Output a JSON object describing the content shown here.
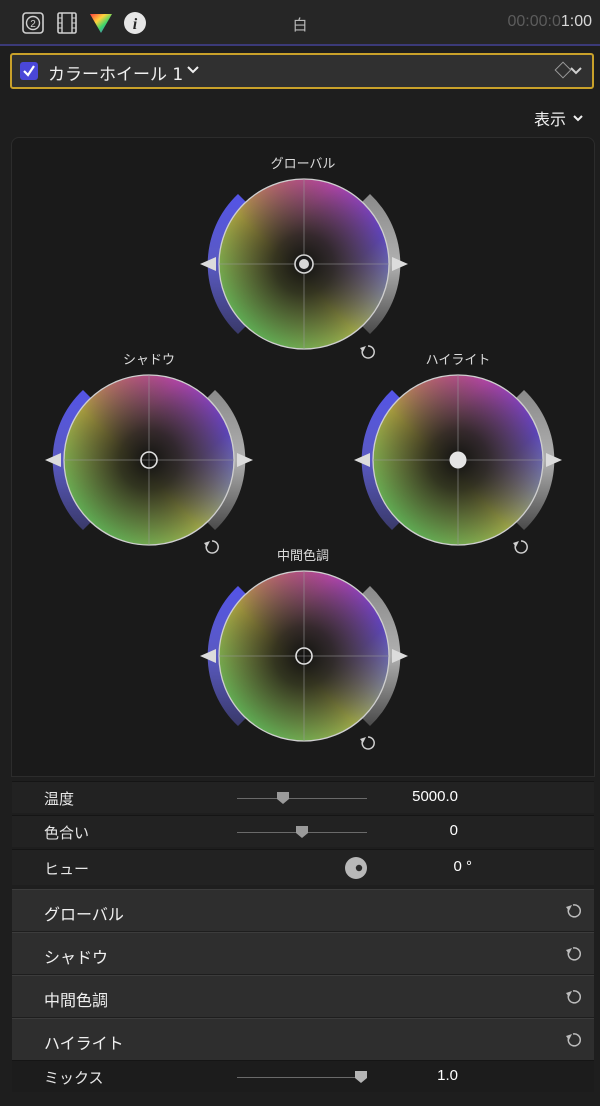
{
  "toolbar": {
    "title": "白",
    "timecode_dim": "00:00:0",
    "timecode_hi": "1:00",
    "icons": [
      "video-inspector-icon",
      "film-icon",
      "color-inspector-icon",
      "info-icon"
    ],
    "badge": "2"
  },
  "effect": {
    "checked": true,
    "name": "カラーホイール 1"
  },
  "show_button": "表示",
  "wheels": {
    "global": {
      "label": "グローバル"
    },
    "shadows": {
      "label": "シャドウ"
    },
    "highlights": {
      "label": "ハイライト"
    },
    "midtones": {
      "label": "中間色調"
    }
  },
  "params": {
    "temperature": {
      "label": "温度",
      "value": "5000.0",
      "position": 0.35
    },
    "tint": {
      "label": "色合い",
      "value": "0",
      "position": 0.5
    },
    "hue": {
      "label": "ヒュー",
      "value": "0 °"
    },
    "mix": {
      "label": "ミックス",
      "value": "1.0",
      "position": 0.95
    }
  },
  "sections": [
    {
      "label": "グローバル"
    },
    {
      "label": "シャドウ"
    },
    {
      "label": "中間色調"
    },
    {
      "label": "ハイライト"
    }
  ],
  "colors": {
    "accent_blue": "#4a47d8",
    "selection_yellow": "#c9a12a"
  }
}
